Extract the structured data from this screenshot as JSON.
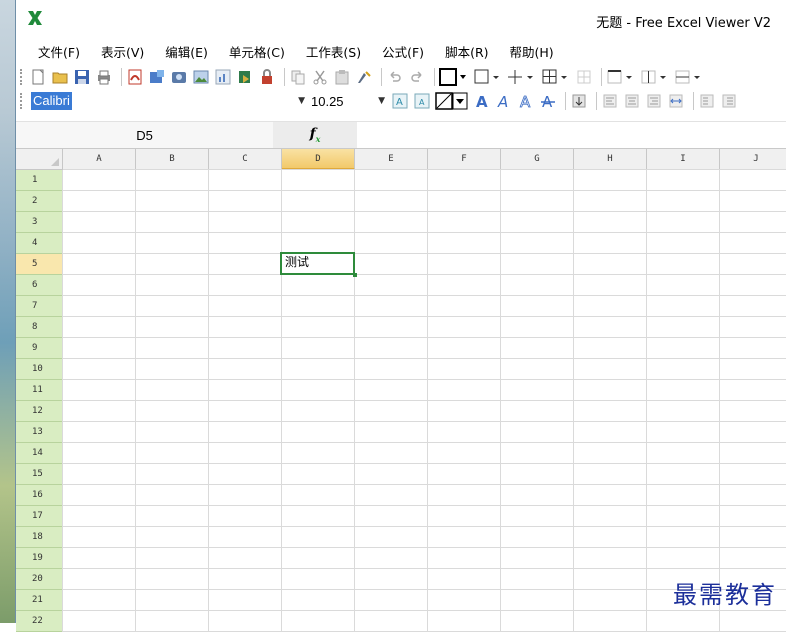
{
  "app": {
    "title": "无题 - Free Excel Viewer V2",
    "accent": "#2e8b3b"
  },
  "menu": [
    "文件(F)",
    "表示(V)",
    "编辑(E)",
    "单元格(C)",
    "工作表(S)",
    "公式(F)",
    "脚本(R)",
    "帮助(H)"
  ],
  "toolbar1_icons": [
    "new-file-icon",
    "open-folder-icon",
    "save-icon",
    "print-icon",
    "pdf-icon",
    "export-icon",
    "image-icon",
    "picture-icon",
    "chart-icon",
    "import-icon",
    "lock-icon",
    "copy-icon",
    "cut-icon",
    "paste-icon",
    "format-painter-icon",
    "undo-icon",
    "redo-icon",
    "border-box-icon",
    "border-none-icon",
    "border-plus-icon",
    "border-all-icon",
    "border-grid-icon",
    "border-top-icon",
    "border-vertical-icon",
    "border-horizontal-icon"
  ],
  "font": {
    "name": "Calibri",
    "size": "10.25"
  },
  "toolbar2_icons": [
    "font-grow-icon",
    "font-shrink-icon",
    "cell-clear-icon",
    "bold-icon",
    "italic-icon",
    "outline-icon",
    "strikethrough-icon",
    "merge-icon",
    "align-left-icon",
    "align-center-icon",
    "align-right-icon",
    "wrap-icon",
    "indent-left-icon",
    "indent-right-icon"
  ],
  "formula_bar": {
    "cell_ref": "D5",
    "fx_label": "f",
    "fx_sub": "x",
    "value": ""
  },
  "columns": [
    "A",
    "B",
    "C",
    "D",
    "E",
    "F",
    "G",
    "H",
    "I",
    "J"
  ],
  "rows": [
    "1",
    "2",
    "3",
    "4",
    "5",
    "6",
    "7",
    "8",
    "9",
    "10",
    "11",
    "12",
    "13",
    "14",
    "15",
    "16",
    "17",
    "18",
    "19",
    "20",
    "21",
    "22"
  ],
  "selection": {
    "column": "D",
    "row": "5"
  },
  "cells": {
    "D5": "测试"
  },
  "watermark": "最需教育"
}
